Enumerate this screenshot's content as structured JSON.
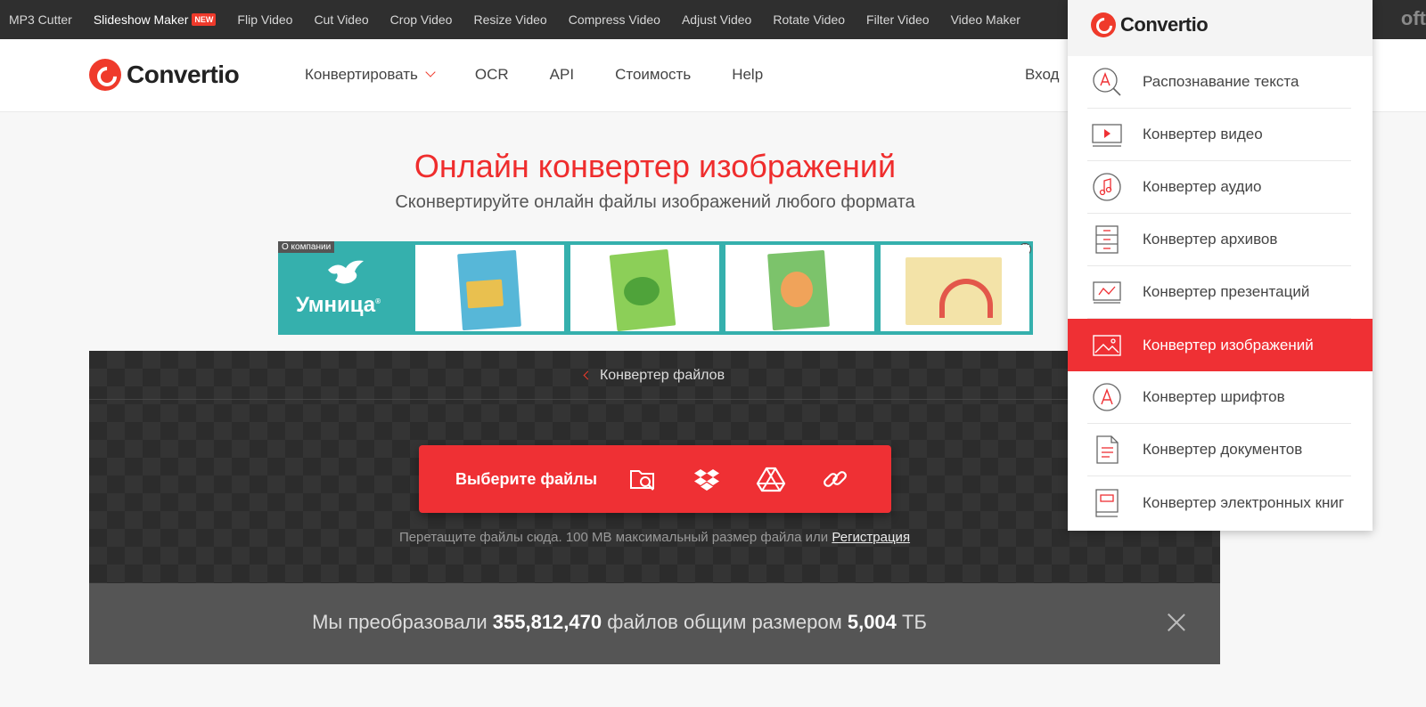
{
  "topbar": {
    "links": [
      {
        "label": "MP3 Cutter"
      },
      {
        "label": "Slideshow Maker",
        "badge": "NEW"
      },
      {
        "label": "Flip Video"
      },
      {
        "label": "Cut Video"
      },
      {
        "label": "Crop Video"
      },
      {
        "label": "Resize Video"
      },
      {
        "label": "Compress Video"
      },
      {
        "label": "Adjust Video"
      },
      {
        "label": "Rotate Video"
      },
      {
        "label": "Filter Video"
      },
      {
        "label": "Video Maker"
      }
    ],
    "brand_partial": "oft"
  },
  "header": {
    "logo_text": "Convertio",
    "nav": {
      "convert": "Конвертировать",
      "ocr": "OCR",
      "api": "API",
      "pricing": "Стоимость",
      "help": "Help"
    },
    "login": "Вход"
  },
  "hero": {
    "title": "Онлайн конвертер изображений",
    "subtitle": "Сконвертируйте онлайн файлы изображений любого формата"
  },
  "ad": {
    "tag": "О компании",
    "brand": "Умница",
    "info_icon": "i"
  },
  "converter": {
    "breadcrumb": "Конвертер файлов",
    "choose_files": "Выберите файлы",
    "hint_text": "Перетащите файлы сюда. 100 MB максимальный размер файла или",
    "register_link": "Регистрация",
    "sources": [
      "folder-search-icon",
      "dropbox-icon",
      "google-drive-icon",
      "link-icon"
    ]
  },
  "stats": {
    "prefix": "Мы преобразовали",
    "files": "355,812,470",
    "middle": "файлов общим размером",
    "size": "5,004",
    "unit": "ТБ"
  },
  "menu": {
    "logo_text": "Convertio",
    "items": [
      {
        "label": "Распознавание текста",
        "icon": "ocr-icon"
      },
      {
        "label": "Конвертер видео",
        "icon": "video-icon"
      },
      {
        "label": "Конвертер аудио",
        "icon": "audio-icon"
      },
      {
        "label": "Конвертер архивов",
        "icon": "archive-icon"
      },
      {
        "label": "Конвертер презентаций",
        "icon": "presentation-icon"
      },
      {
        "label": "Конвертер изображений",
        "icon": "image-icon",
        "active": true
      },
      {
        "label": "Конвертер шрифтов",
        "icon": "font-icon"
      },
      {
        "label": "Конвертер документов",
        "icon": "document-icon"
      },
      {
        "label": "Конвертер электронных книг",
        "icon": "ebook-icon"
      }
    ]
  },
  "colors": {
    "accent": "#ef3034",
    "title_red": "#ef2d2d",
    "topbar_bg": "#2f2f2f",
    "ad_teal": "#35b0ad"
  }
}
